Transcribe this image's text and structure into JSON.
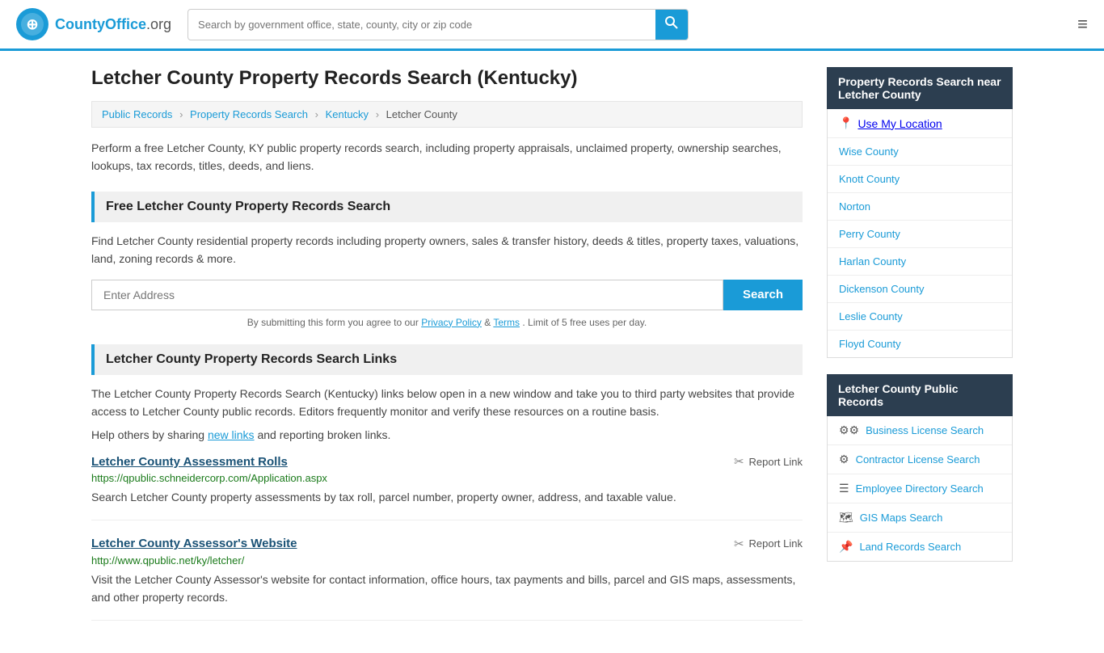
{
  "header": {
    "logo_text": "CountyOffice",
    "logo_tld": ".org",
    "search_placeholder": "Search by government office, state, county, city or zip code",
    "menu_icon": "≡"
  },
  "page": {
    "title": "Letcher County Property Records Search (Kentucky)",
    "breadcrumb": [
      {
        "label": "Public Records",
        "href": "#"
      },
      {
        "label": "Property Records Search",
        "href": "#"
      },
      {
        "label": "Kentucky",
        "href": "#"
      },
      {
        "label": "Letcher County",
        "href": "#"
      }
    ],
    "description": "Perform a free Letcher County, KY public property records search, including property appraisals, unclaimed property, ownership searches, lookups, tax records, titles, deeds, and liens."
  },
  "free_search": {
    "heading": "Free Letcher County Property Records Search",
    "description": "Find Letcher County residential property records including property owners, sales & transfer history, deeds & titles, property taxes, valuations, land, zoning records & more.",
    "address_placeholder": "Enter Address",
    "search_button": "Search",
    "disclaimer": "By submitting this form you agree to our",
    "privacy_label": "Privacy Policy",
    "terms_label": "Terms",
    "disclaimer_end": ". Limit of 5 free uses per day."
  },
  "links_section": {
    "heading": "Letcher County Property Records Search Links",
    "description": "The Letcher County Property Records Search (Kentucky) links below open in a new window and take you to third party websites that provide access to Letcher County public records. Editors frequently monitor and verify these resources on a routine basis.",
    "help_text": "Help others by sharing",
    "new_links_label": "new links",
    "help_text_end": "and reporting broken links.",
    "links": [
      {
        "title": "Letcher County Assessment Rolls",
        "url": "https://qpublic.schneidercorp.com/Application.aspx",
        "description": "Search Letcher County property assessments by tax roll, parcel number, property owner, address, and taxable value.",
        "report_label": "Report Link"
      },
      {
        "title": "Letcher County Assessor's Website",
        "url": "http://www.qpublic.net/ky/letcher/",
        "description": "Visit the Letcher County Assessor's website for contact information, office hours, tax payments and bills, parcel and GIS maps, assessments, and other property records.",
        "report_label": "Report Link"
      }
    ]
  },
  "sidebar": {
    "nearby_header": "Property Records Search near Letcher County",
    "use_location_label": "Use My Location",
    "nearby_places": [
      {
        "label": "Wise County",
        "href": "#"
      },
      {
        "label": "Knott County",
        "href": "#"
      },
      {
        "label": "Norton",
        "href": "#"
      },
      {
        "label": "Perry County",
        "href": "#"
      },
      {
        "label": "Harlan County",
        "href": "#"
      },
      {
        "label": "Dickenson County",
        "href": "#"
      },
      {
        "label": "Leslie County",
        "href": "#"
      },
      {
        "label": "Floyd County",
        "href": "#"
      }
    ],
    "public_records_header": "Letcher County Public Records",
    "public_records": [
      {
        "label": "Business License Search",
        "href": "#",
        "icon": "⚙"
      },
      {
        "label": "Contractor License Search",
        "href": "#",
        "icon": "⚙"
      },
      {
        "label": "Employee Directory Search",
        "href": "#",
        "icon": "☰"
      },
      {
        "label": "GIS Maps Search",
        "href": "#",
        "icon": "🗺"
      },
      {
        "label": "Land Records Search",
        "href": "#",
        "icon": "📌"
      }
    ]
  }
}
